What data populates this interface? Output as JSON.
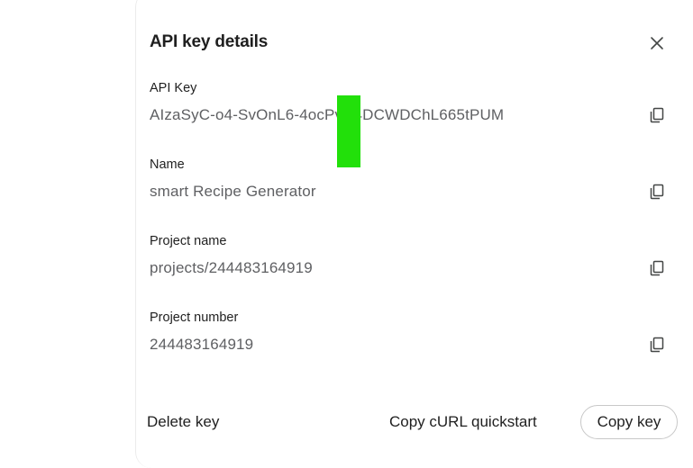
{
  "dialog": {
    "title": "API key details",
    "close_icon": "close-icon"
  },
  "fields": [
    {
      "label": "API Key",
      "value": "AIzaSyC-o4-SvOnL6-4ocPvH4DCWDChL665tPUM",
      "icon": "copy-icon"
    },
    {
      "label": "Name",
      "value": "smart Recipe Generator",
      "icon": "copy-icon"
    },
    {
      "label": "Project name",
      "value": "projects/244483164919",
      "icon": "copy-icon"
    },
    {
      "label": "Project number",
      "value": "244483164919",
      "icon": "copy-icon"
    }
  ],
  "footer": {
    "delete_label": "Delete key",
    "curl_label": "Copy cURL quickstart",
    "copy_key_label": "Copy key"
  },
  "colors": {
    "redaction": "#22e00a",
    "text_primary": "#1f1f1f",
    "text_secondary": "#5f6063"
  }
}
